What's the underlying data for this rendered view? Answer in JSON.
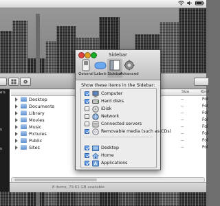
{
  "menubar": {
    "status_icons": [
      "wifi-icon",
      "speaker-icon",
      "battery-icon"
    ]
  },
  "finder": {
    "sidebar_fragments": [
      "e's",
      "s",
      "s"
    ],
    "columns": {
      "date": "",
      "size": "Size",
      "kind": "Kind"
    },
    "rows": [
      {
        "name": "Desktop",
        "size": "--",
        "kind": "Fol"
      },
      {
        "name": "Documents",
        "size": "--",
        "kind": "Fol"
      },
      {
        "name": "Library",
        "size": "--",
        "kind": "Fol"
      },
      {
        "name": "Movies",
        "size": "--",
        "kind": "Fol"
      },
      {
        "name": "Music",
        "size": "--",
        "kind": "Fol"
      },
      {
        "name": "Pictures",
        "size": "--",
        "kind": "Fol"
      },
      {
        "name": "Public",
        "size": "--",
        "kind": "Fol"
      },
      {
        "name": "Sites",
        "size": "--",
        "kind": "Fol"
      }
    ],
    "status": "8 items, 79.61 GB available"
  },
  "prefs": {
    "title": "Sidebar",
    "tabs": [
      {
        "label": "General",
        "icon": "switch-icon"
      },
      {
        "label": "Labels",
        "icon": "label-icon"
      },
      {
        "label": "Sidebar",
        "icon": "sidebar-icon"
      },
      {
        "label": "Advanced",
        "icon": "gear-icon"
      }
    ],
    "selected_tab": "Sidebar",
    "heading": "Show these items in the Sidebar:",
    "items": [
      {
        "label": "Computer",
        "checked": true,
        "icon": "computer-icon"
      },
      {
        "label": "Hard disks",
        "checked": true,
        "icon": "hard-disk-icon"
      },
      {
        "label": "iDisk",
        "checked": false,
        "icon": "idisk-icon"
      },
      {
        "label": "Network",
        "checked": false,
        "icon": "network-icon"
      },
      {
        "label": "Connected servers",
        "checked": false,
        "icon": "server-icon"
      },
      {
        "label": "Removable media (such as CDs)",
        "checked": true,
        "icon": "cd-icon"
      },
      {
        "label": "Desktop",
        "checked": true,
        "icon": "desktop-icon"
      },
      {
        "label": "Home",
        "checked": true,
        "icon": "home-icon"
      },
      {
        "label": "Applications",
        "checked": true,
        "icon": "applications-icon"
      }
    ]
  },
  "colors": {
    "accent": "#2a6fd1",
    "close": "#e0443e",
    "minimize": "#dea123",
    "zoom": "#1aab29"
  }
}
